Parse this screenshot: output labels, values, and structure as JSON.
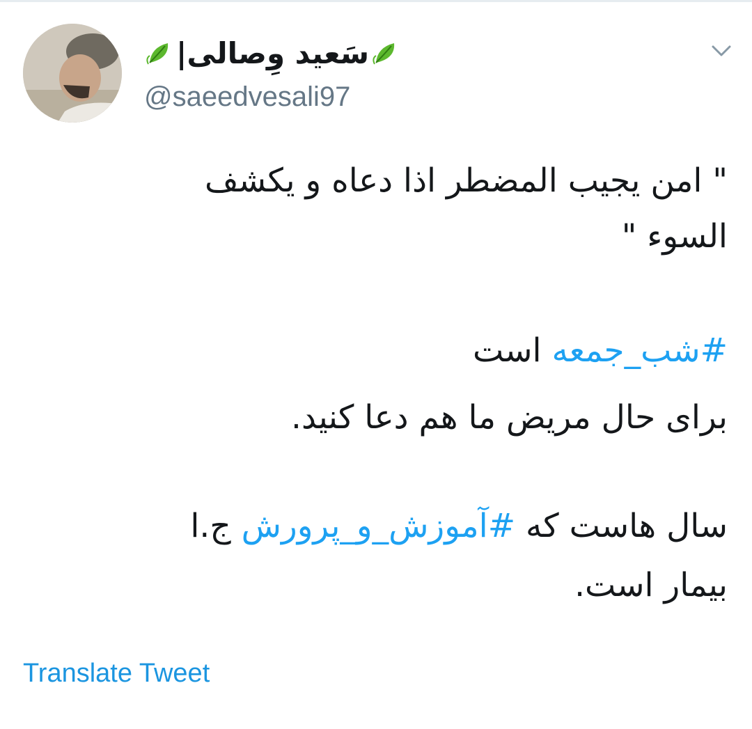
{
  "tweet": {
    "author": {
      "display_name": "سَعید وِصالی|",
      "name_emoji": "leaf-icon",
      "handle": "@saeedvesali97"
    },
    "menu_icon": "chevron-down-icon",
    "lines": {
      "line1": "\" امن یجیب المضطر اذا دعاه و یکشف",
      "line2": "السوء \"",
      "line3_hashtag": "#شب_جمعه",
      "line3_text": " است",
      "line4": "برای حال مریض ما هم دعا کنید.",
      "line5_text_before": "سال هاست که ",
      "line5_hashtag": "#آموزش_و_پرورش",
      "line5_text_after": " ج.ا",
      "line6": "بیمار است."
    },
    "translate_label": "Translate Tweet"
  },
  "colors": {
    "text": "#14171a",
    "secondary": "#657786",
    "link": "#1da1f2",
    "translate": "#1b95e0"
  }
}
